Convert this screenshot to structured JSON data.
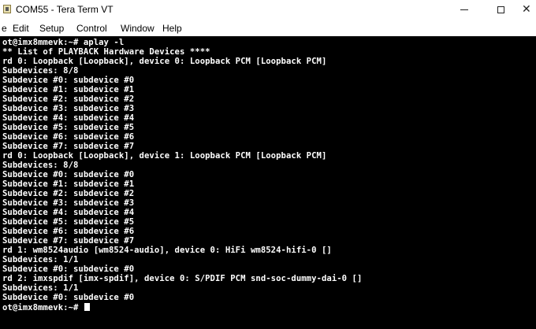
{
  "window": {
    "title": "COM55 - Tera Term VT",
    "app_icon": "tera-term-icon",
    "controls": {
      "minimize_glyph": "—",
      "maximize_glyph": "☐",
      "close_glyph": "✕"
    }
  },
  "menu": {
    "items": [
      "e",
      "Edit",
      "Setup",
      "Control",
      "Window",
      "Help"
    ]
  },
  "terminal": {
    "background": "#000000",
    "foreground": "#ffffff",
    "prompt_line": "ot@imx8mmevk:~# ",
    "lines": [
      "ot@imx8mmevk:~# aplay -l",
      "** List of PLAYBACK Hardware Devices ****",
      "rd 0: Loopback [Loopback], device 0: Loopback PCM [Loopback PCM]",
      "Subdevices: 8/8",
      "Subdevice #0: subdevice #0",
      "Subdevice #1: subdevice #1",
      "Subdevice #2: subdevice #2",
      "Subdevice #3: subdevice #3",
      "Subdevice #4: subdevice #4",
      "Subdevice #5: subdevice #5",
      "Subdevice #6: subdevice #6",
      "Subdevice #7: subdevice #7",
      "rd 0: Loopback [Loopback], device 1: Loopback PCM [Loopback PCM]",
      "Subdevices: 8/8",
      "Subdevice #0: subdevice #0",
      "Subdevice #1: subdevice #1",
      "Subdevice #2: subdevice #2",
      "Subdevice #3: subdevice #3",
      "Subdevice #4: subdevice #4",
      "Subdevice #5: subdevice #5",
      "Subdevice #6: subdevice #6",
      "Subdevice #7: subdevice #7",
      "rd 1: wm8524audio [wm8524-audio], device 0: HiFi wm8524-hifi-0 []",
      "Subdevices: 1/1",
      "Subdevice #0: subdevice #0",
      "rd 2: imxspdif [imx-spdif], device 0: S/PDIF PCM snd-soc-dummy-dai-0 []",
      "Subdevices: 1/1",
      "Subdevice #0: subdevice #0"
    ]
  }
}
